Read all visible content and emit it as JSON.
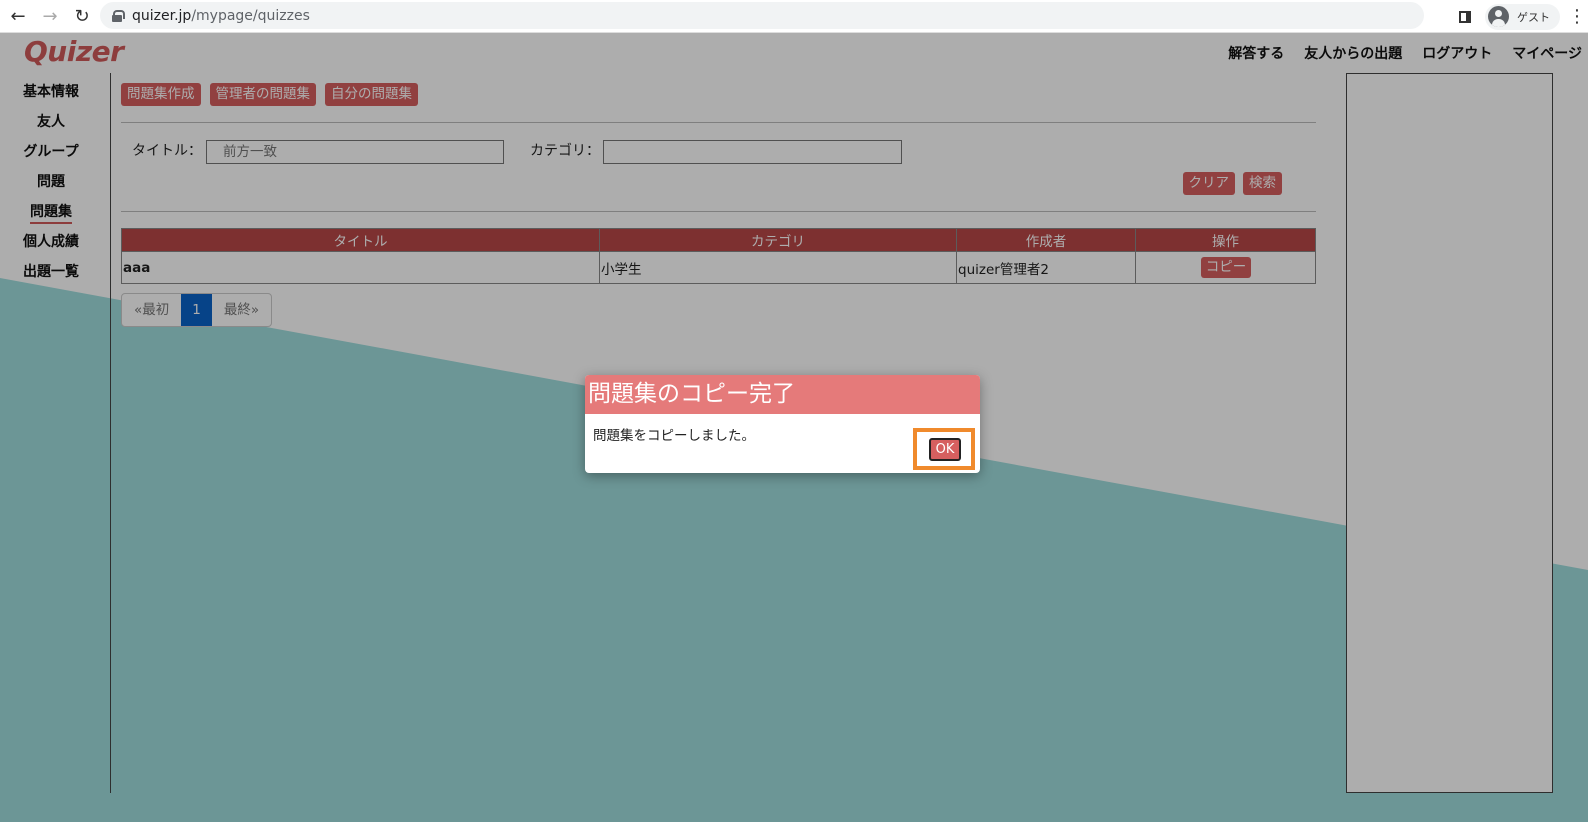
{
  "browser": {
    "url_host": "quizer.jp",
    "url_path": "/mypage/quizzes",
    "profile_name": "ゲスト"
  },
  "header": {
    "logo": "Quizer",
    "nav": [
      "解答する",
      "友人からの出題",
      "ログアウト",
      "マイページ"
    ]
  },
  "sidebar": {
    "items": [
      {
        "label": "基本情報"
      },
      {
        "label": "友人"
      },
      {
        "label": "グループ"
      },
      {
        "label": "問題"
      },
      {
        "label": "問題集",
        "active": true
      },
      {
        "label": "個人成績"
      },
      {
        "label": "出題一覧"
      }
    ]
  },
  "toolbar": {
    "create": "問題集作成",
    "admin_sets": "管理者の問題集",
    "my_sets": "自分の問題集"
  },
  "search": {
    "title_label": "タイトル：",
    "title_placeholder": "前方一致",
    "category_label": "カテゴリ：",
    "category_value": "",
    "clear": "クリア",
    "search": "検索"
  },
  "table": {
    "headers": [
      "タイトル",
      "カテゴリ",
      "作成者",
      "操作"
    ],
    "rows": [
      {
        "title": "aaa",
        "category": "小学生",
        "author": "quizer管理者2",
        "action": "コピー"
      }
    ]
  },
  "pager": {
    "first": "«最初",
    "current": "1",
    "last": "最終»"
  },
  "dialog": {
    "title": "問題集のコピー完了",
    "message": "問題集をコピーしました。",
    "ok": "OK"
  },
  "colors": {
    "accent": "#d65f5f",
    "dialog_header": "#e57a7a",
    "highlight": "#f08a2c",
    "pager_active": "#0a63c9",
    "wave": "#9fdede"
  }
}
